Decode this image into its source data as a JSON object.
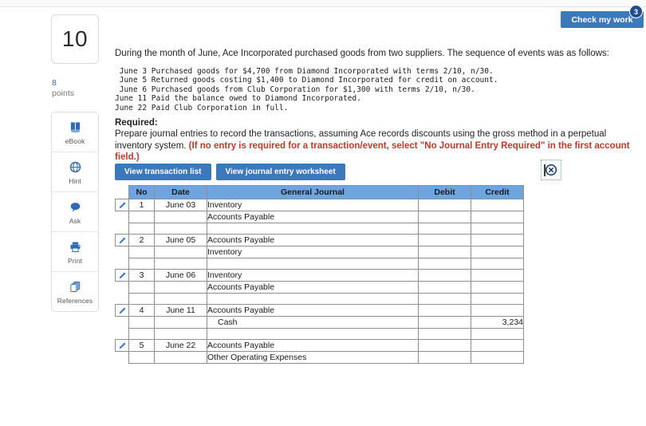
{
  "header": {
    "check_my_work_label": "Check my work",
    "check_my_work_badge": "3"
  },
  "rail": {
    "question_number": "10",
    "points_value": "8",
    "points_label": "points",
    "tools": [
      {
        "icon": "ebook-icon",
        "label": "eBook"
      },
      {
        "icon": "hint-icon",
        "label": "Hint"
      },
      {
        "icon": "ask-icon",
        "label": "Ask"
      },
      {
        "icon": "print-icon",
        "label": "Print"
      },
      {
        "icon": "references-icon",
        "label": "References"
      }
    ]
  },
  "problem": {
    "intro": "During the month of June, Ace Incorporated purchased goods from two suppliers. The sequence of events was as follows:",
    "events": " June 3 Purchased goods for $4,700 from Diamond Incorporated with terms 2/10, n/30.\n June 5 Returned goods costing $1,400 to Diamond Incorporated for credit on account.\n June 6 Purchased goods from Club Corporation for $1,300 with terms 2/10, n/30.\nJune 11 Paid the balance owed to Diamond Incorporated.\nJune 22 Paid Club Corporation in full.",
    "required_heading": "Required:",
    "required_text": "Prepare journal entries to record the transactions, assuming Ace records discounts using the gross method in a perpetual inventory system. ",
    "required_note": "(If no entry is required for a transaction/event, select \"No Journal Entry Required\" in the first account field.)"
  },
  "tabs": [
    {
      "label": "View transaction list"
    },
    {
      "label": "View journal entry worksheet"
    }
  ],
  "icons": {
    "broken_image": "broken-image-icon"
  },
  "table": {
    "columns": [
      "No",
      "Date",
      "General Journal",
      "Debit",
      "Credit"
    ],
    "rows": [
      {
        "pencil": true,
        "no": "1",
        "date": "June 03",
        "account": "Inventory",
        "indent": false,
        "debit": "",
        "credit": ""
      },
      {
        "pencil": false,
        "no": "",
        "date": "",
        "account": "Accounts Payable",
        "indent": false,
        "debit": "",
        "credit": ""
      },
      {
        "pencil": false,
        "no": "",
        "date": "",
        "account": "",
        "indent": false,
        "debit": "",
        "credit": ""
      },
      {
        "pencil": true,
        "no": "2",
        "date": "June 05",
        "account": "Accounts Payable",
        "indent": false,
        "debit": "",
        "credit": ""
      },
      {
        "pencil": false,
        "no": "",
        "date": "",
        "account": "Inventory",
        "indent": false,
        "debit": "",
        "credit": ""
      },
      {
        "pencil": false,
        "no": "",
        "date": "",
        "account": "",
        "indent": false,
        "debit": "",
        "credit": ""
      },
      {
        "pencil": true,
        "no": "3",
        "date": "June 06",
        "account": "Inventory",
        "indent": false,
        "debit": "",
        "credit": ""
      },
      {
        "pencil": false,
        "no": "",
        "date": "",
        "account": "Accounts Payable",
        "indent": false,
        "debit": "",
        "credit": ""
      },
      {
        "pencil": false,
        "no": "",
        "date": "",
        "account": "",
        "indent": false,
        "debit": "",
        "credit": ""
      },
      {
        "pencil": true,
        "no": "4",
        "date": "June 11",
        "account": "Accounts Payable",
        "indent": false,
        "debit": "",
        "credit": ""
      },
      {
        "pencil": false,
        "no": "",
        "date": "",
        "account": "Cash",
        "indent": true,
        "debit": "",
        "credit": "3,234"
      },
      {
        "pencil": false,
        "no": "",
        "date": "",
        "account": "",
        "indent": false,
        "debit": "",
        "credit": ""
      },
      {
        "pencil": true,
        "no": "5",
        "date": "June 22",
        "account": "Accounts Payable",
        "indent": false,
        "debit": "",
        "credit": ""
      },
      {
        "pencil": false,
        "no": "",
        "date": "",
        "account": "Other Operating Expenses",
        "indent": false,
        "debit": "",
        "credit": ""
      }
    ]
  }
}
